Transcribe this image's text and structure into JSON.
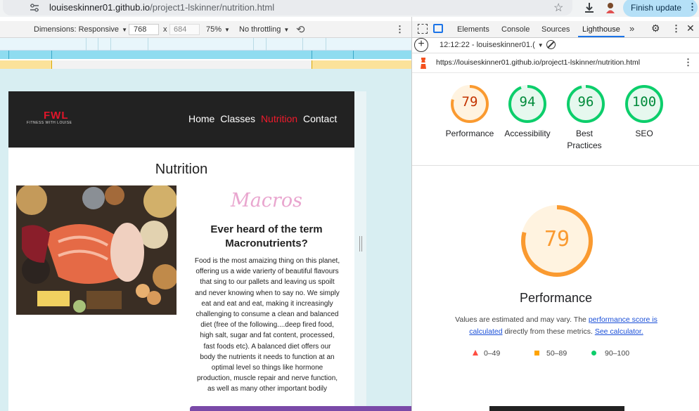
{
  "browser": {
    "url_host": "louiseskinner01.github.io",
    "url_path": "/project1-lskinner/nutrition.html",
    "finish_update_label": "Finish update"
  },
  "device_toolbar": {
    "dimensions_label": "Dimensions: Responsive",
    "width_value": "768",
    "height_value": "684",
    "zoom": "75%",
    "throttling": "No throttling"
  },
  "site": {
    "logo_text": "FWL",
    "logo_subtext": "FITNESS WITH LOUISE",
    "nav": [
      "Home",
      "Classes",
      "Nutrition",
      "Contact"
    ],
    "active_nav": "Nutrition",
    "page_title": "Nutrition",
    "macros_title": "Macros",
    "question": "Ever heard of the term Macronutrients?",
    "body_lines": [
      "Food is the most amaizing thing on this planet,",
      "offering us a wide varierty of beautiful flavours",
      "that sing to our pallets and leaving us spoilt",
      "and never knowing when to say no. We simply",
      "eat and eat and eat, making it increasingly",
      "challenging to consume a clean and balanced",
      "diet (free of the following....deep fired food,",
      "high salt, sugar and fat content, processed,",
      "fast foods etc). A balanced diet offers our",
      "body the nutrients it needs to function at an",
      "optimal level so things like hormone",
      "production, muscle repair and nerve function,",
      "as well as many other important bodily"
    ]
  },
  "devtools": {
    "tabs": [
      "Elements",
      "Console",
      "Sources",
      "Lighthouse"
    ],
    "active_tab": "Lighthouse",
    "report_time": "12:12:22 - louiseskinner01.(",
    "report_url": "https://louiseskinner01.github.io/project1-lskinner/nutrition.html",
    "scores": [
      {
        "label": "Performance",
        "value": 79,
        "color": "#fa9a30"
      },
      {
        "label": "Accessibility",
        "value": 94,
        "color": "#0cce6b"
      },
      {
        "label": "Best Practices",
        "value": 96,
        "color": "#0cce6b"
      },
      {
        "label": "SEO",
        "value": 100,
        "color": "#0cce6b"
      }
    ],
    "big_score": {
      "label": "Performance",
      "value": 79
    },
    "note_text_1": "Values are estimated and may vary. The ",
    "note_link_1": "performance score is calculated",
    "note_text_2": " directly from these metrics. ",
    "note_link_2": "See calculator.",
    "legend": [
      {
        "range": "0–49",
        "color": "#ff4e42"
      },
      {
        "range": "50–89",
        "color": "#ffa400"
      },
      {
        "range": "90–100",
        "color": "#0cce6b"
      }
    ]
  }
}
